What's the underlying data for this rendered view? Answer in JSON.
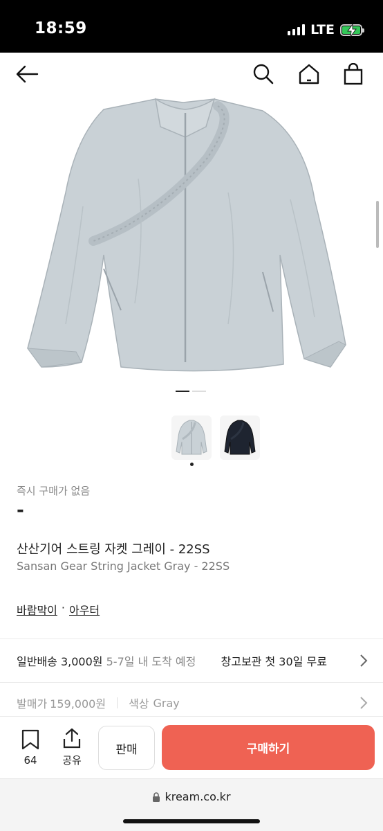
{
  "status_bar": {
    "time": "18:59",
    "network": "LTE"
  },
  "nav": {
    "icons": [
      "back-arrow-icon",
      "search-icon",
      "home-icon",
      "shopping-bag-icon"
    ]
  },
  "product": {
    "immediate_purchase_label": "즉시 구매가 없음",
    "price": "-",
    "name_ko": "산산기어 스트링 자켓 그레이 - 22SS",
    "name_en": "Sansan Gear String Jacket Gray - 22SS",
    "categories": [
      "바람막이",
      "아우터"
    ],
    "category_separator": "·"
  },
  "shipping": {
    "method": "일반배송",
    "price": "3,000원",
    "eta": "5-7일 내 도착 예정",
    "storage_label": "창고보관",
    "storage_text": "첫 30일 무료"
  },
  "spec": {
    "release_price_label": "발매가",
    "release_price": "159,000원",
    "color_label": "색상",
    "color": "Gray"
  },
  "bottom_bar": {
    "wish_count": "64",
    "share_label": "공유",
    "sell_label": "판매",
    "buy_label": "구매하기"
  },
  "browser": {
    "url": "kream.co.kr"
  },
  "colors": {
    "accent": "#ef6253",
    "jacket_gray": "#c9d1d6",
    "jacket_navy": "#1e2430"
  }
}
